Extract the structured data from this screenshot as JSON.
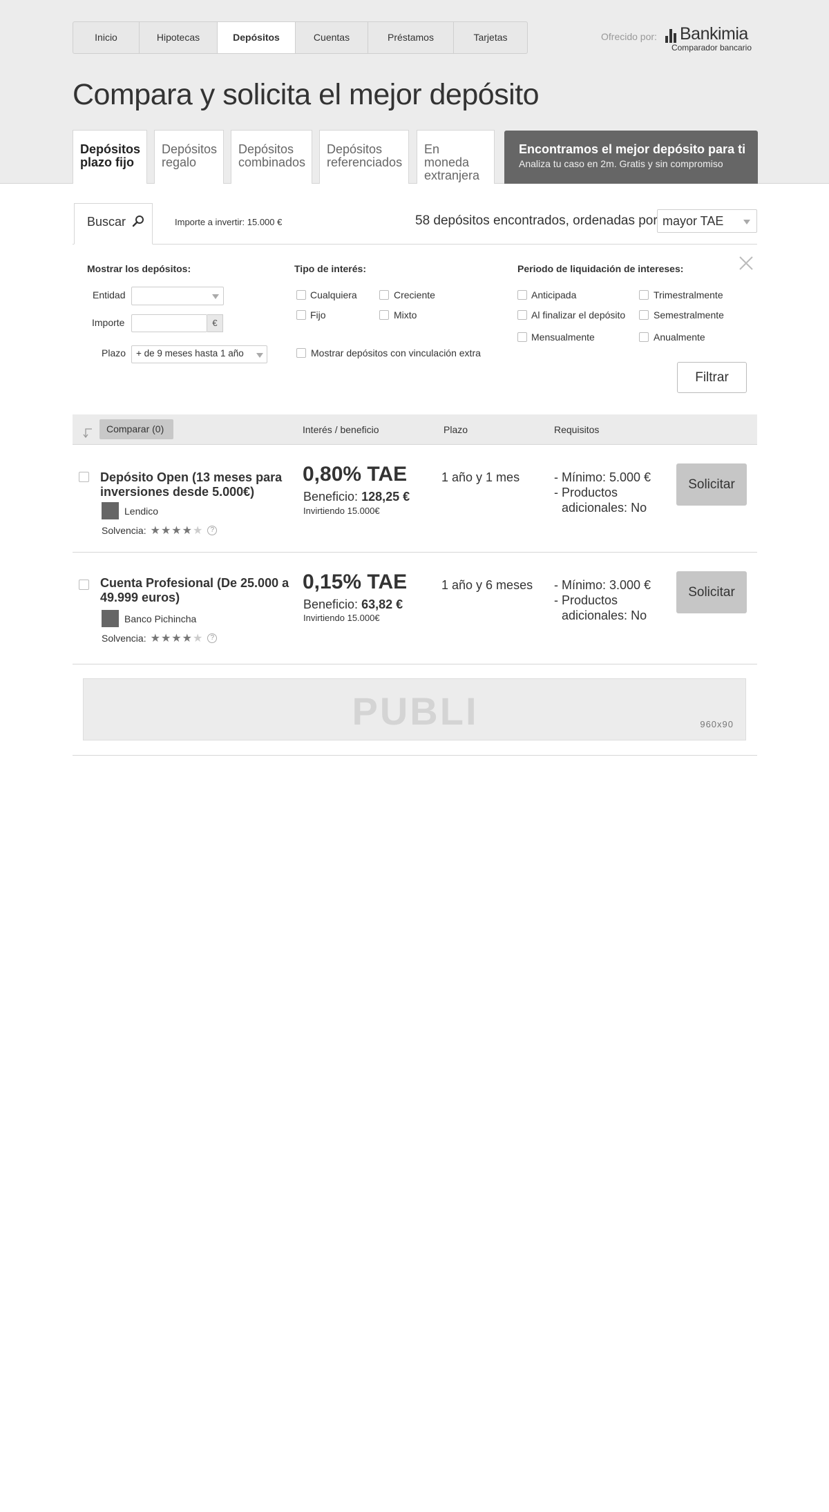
{
  "nav": {
    "items": [
      {
        "label": "Inicio",
        "active": false
      },
      {
        "label": "Hipotecas",
        "active": false
      },
      {
        "label": "Depósitos",
        "active": true
      },
      {
        "label": "Cuentas",
        "active": false
      },
      {
        "label": "Préstamos",
        "active": false
      },
      {
        "label": "Tarjetas",
        "active": false
      }
    ]
  },
  "brand": {
    "offered_by": "Ofrecido por:",
    "name": "Bankimia",
    "subtitle": "Comparador bancario"
  },
  "page_title": "Compara y solicita el mejor depósito",
  "categories": [
    {
      "line1": "Depósitos",
      "line2": "plazo fijo",
      "active": true
    },
    {
      "line1": "Depósitos",
      "line2": "regalo",
      "active": false
    },
    {
      "line1": "Depósitos",
      "line2": "combinados",
      "active": false
    },
    {
      "line1": "Depósitos",
      "line2": "referenciados",
      "active": false
    },
    {
      "line1": "En moneda",
      "line2": "extranjera",
      "active": false
    }
  ],
  "promo": {
    "title": "Encontramos el mejor depósito para ti",
    "subtitle": "Analiza tu caso en 2m. Gratis y sin compromiso"
  },
  "search": {
    "tab_label": "Buscar",
    "amount_info": "Importe a invertir: 15.000 €",
    "results_info": "58 depósitos encontrados, ordenadas por:",
    "sort_value": "mayor TAE"
  },
  "filters": {
    "show_heading": "Mostrar los depósitos:",
    "entidad_label": "Entidad",
    "entidad_value": "",
    "importe_label": "Importe",
    "importe_value": "",
    "currency": "€",
    "plazo_label": "Plazo",
    "plazo_value": "+ de 9 meses hasta 1 año",
    "interest_heading": "Tipo de interés:",
    "interest_options": [
      "Cualquiera",
      "Creciente",
      "Fijo",
      "Mixto"
    ],
    "extra_option": "Mostrar depósitos con vinculación extra",
    "period_heading": "Periodo de liquidación de intereses:",
    "period_options": [
      "Anticipada",
      "Trimestralmente",
      "Al finalizar el depósito",
      "Semestralmente",
      "Mensualmente",
      "Anualmente"
    ],
    "filter_button": "Filtrar"
  },
  "table": {
    "compare_label": "Comparar (0)",
    "col_interest": "Interés / beneficio",
    "col_plazo": "Plazo",
    "col_req": "Requisitos"
  },
  "results": [
    {
      "name": "Depósito Open (13 meses para inversiones desde 5.000€)",
      "bank": "Lendico",
      "solvency_label": "Solvencia:",
      "stars": 4,
      "stars_max": 5,
      "tae": "0,80% TAE",
      "benefit_label": "Beneficio:",
      "benefit_value": "128,25 €",
      "invest_note": "Invirtiendo 15.000€",
      "plazo": "1 año y 1 mes",
      "req1": "- Mínimo: 5.000 €",
      "req2a": "- Productos",
      "req2b": "adicionales: No",
      "button": "Solicitar"
    },
    {
      "name": "Cuenta Profesional (De 25.000 a 49.999 euros)",
      "bank": "Banco Pichincha",
      "solvency_label": "Solvencia:",
      "stars": 4,
      "stars_max": 5,
      "tae": "0,15% TAE",
      "benefit_label": "Beneficio:",
      "benefit_value": "63,82 €",
      "invest_note": "Invirtiendo 15.000€",
      "plazo": "1 año y 6 meses",
      "req1": "- Mínimo: 3.000 €",
      "req2a": "- Productos",
      "req2b": "adicionales: No",
      "button": "Solicitar"
    }
  ],
  "ad": {
    "label": "PUBLI",
    "size": "960x90"
  }
}
